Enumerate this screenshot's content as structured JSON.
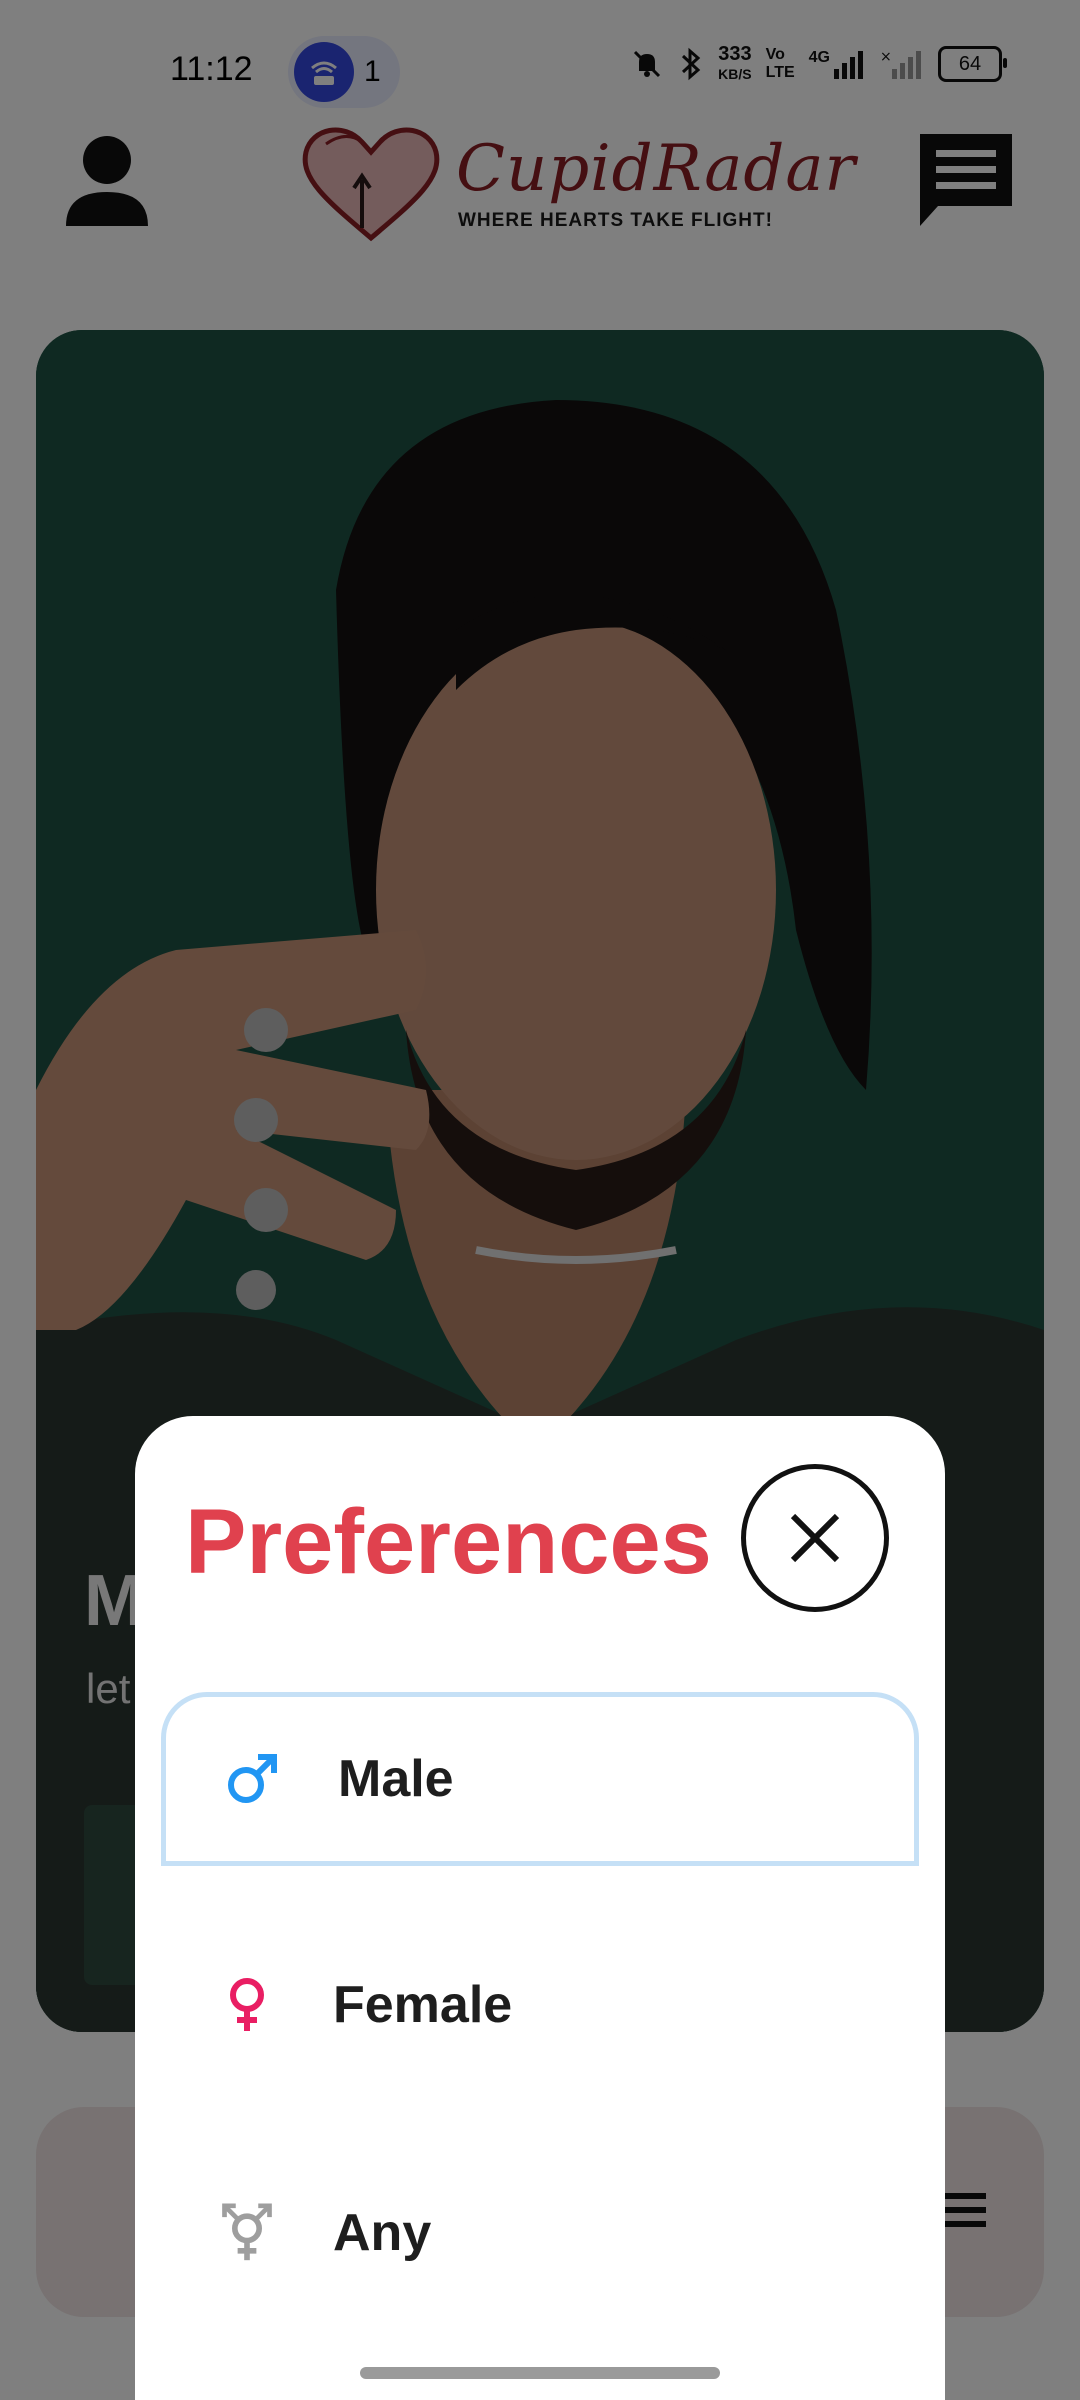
{
  "status_bar": {
    "time": "11:12",
    "hotspot_count": "1",
    "net_speed_value": "333",
    "net_speed_unit": "KB/S",
    "volte_top": "Vo",
    "volte_bottom": "LTE",
    "network": "4G",
    "battery": "64"
  },
  "header": {
    "logo_title": "CupidRadar",
    "logo_tagline": "WHERE HEARTS TAKE FLIGHT!"
  },
  "profile_card": {
    "name": "M",
    "bio": "let"
  },
  "preferences": {
    "title": "Preferences",
    "options": [
      {
        "label": "Male",
        "icon": "male-icon",
        "color": "#2196f3",
        "selected": true
      },
      {
        "label": "Female",
        "icon": "female-icon",
        "color": "#e91e63",
        "selected": false
      },
      {
        "label": "Any",
        "icon": "transgender-icon",
        "color": "#9e9e9e",
        "selected": false
      }
    ]
  },
  "colors": {
    "accent": "#e0414e",
    "brand": "#8b1e25",
    "selected_border": "#c5e0f6"
  }
}
